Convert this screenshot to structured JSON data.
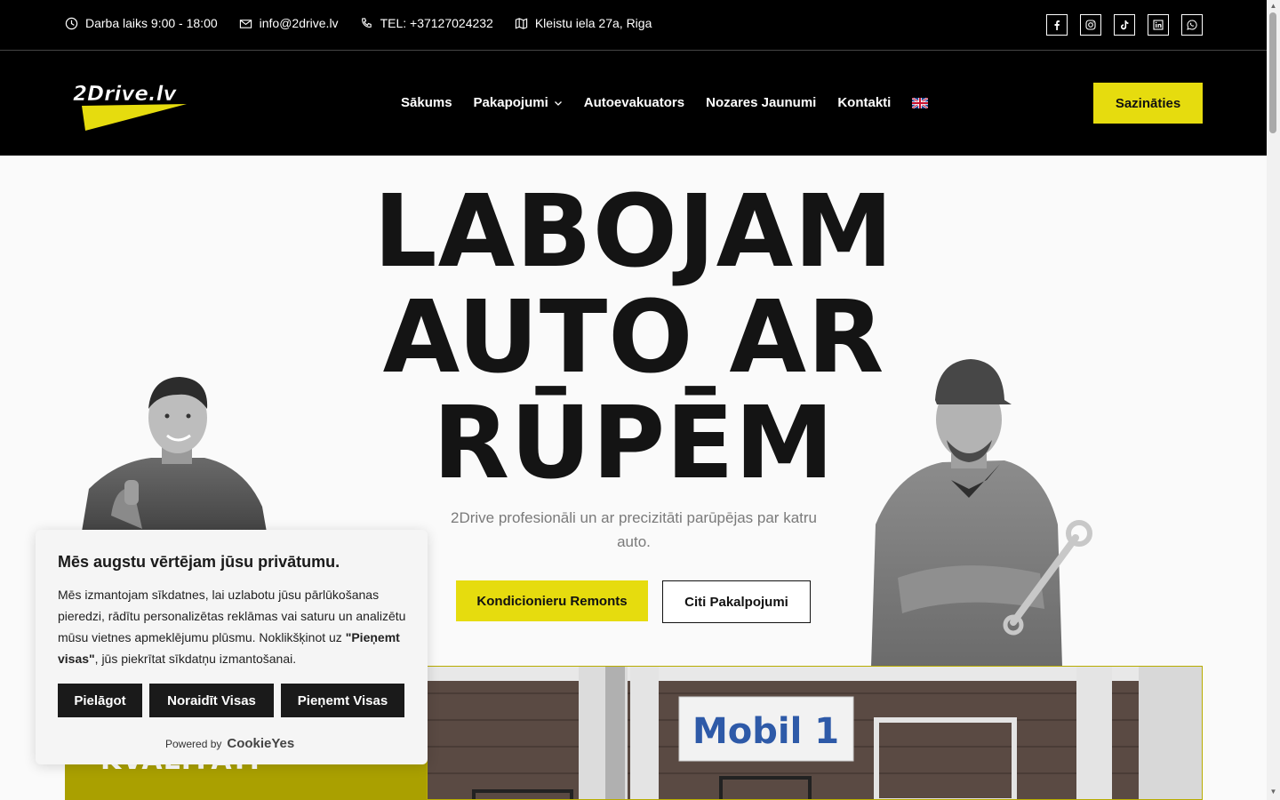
{
  "topbar": {
    "hours": "Darba laiks 9:00 - 18:00",
    "email": "info@2drive.lv",
    "phone": "TEL: +37127024232",
    "address": "Kleistu iela 27a, Riga",
    "socials": [
      "facebook-icon",
      "instagram-icon",
      "tiktok-icon",
      "linkedin-icon",
      "whatsapp-icon"
    ]
  },
  "nav": {
    "logo_text": "2Drive.lv",
    "items": [
      "Sākums",
      "Pakapojumi",
      "Autoevakuators",
      "Nozares Jaunumi",
      "Kontakti"
    ],
    "language": "en-flag-icon",
    "cta": "Sazināties"
  },
  "hero": {
    "title_lines": [
      "LABOJAM",
      "AUTO AR",
      "RŪPĒM"
    ],
    "subtitle": "2Drive profesionāli un ar precizitāti parūpējas par katru auto.",
    "primary_button": "Kondicionieru Remonts",
    "secondary_button": "Citi Pakalpojumi"
  },
  "lower": {
    "panel_text": "KVALITĀTI",
    "photo_sign": "Mobil 1"
  },
  "cookie": {
    "title": "Mēs augstu vērtējam jūsu privātumu.",
    "text_before": "Mēs izmantojam sīkdatnes, lai uzlabotu jūsu pārlūkošanas pieredzi, rādītu personalizētas reklāmas vai saturu un analizētu mūsu vietnes apmeklējumu plūsmu. Noklikšķinot uz ",
    "text_bold": "\"Pieņemt visas\"",
    "text_after": ", jūs piekrītat sīkdatņu izmantošanai.",
    "btn_customize": "Pielāgot",
    "btn_reject": "Noraidīt Visas",
    "btn_accept": "Pieņemt Visas",
    "powered": "Powered by",
    "brand": "CookieYes"
  },
  "colors": {
    "accent": "#e6dc0e",
    "dark": "#000000",
    "olive": "#aaa000"
  }
}
